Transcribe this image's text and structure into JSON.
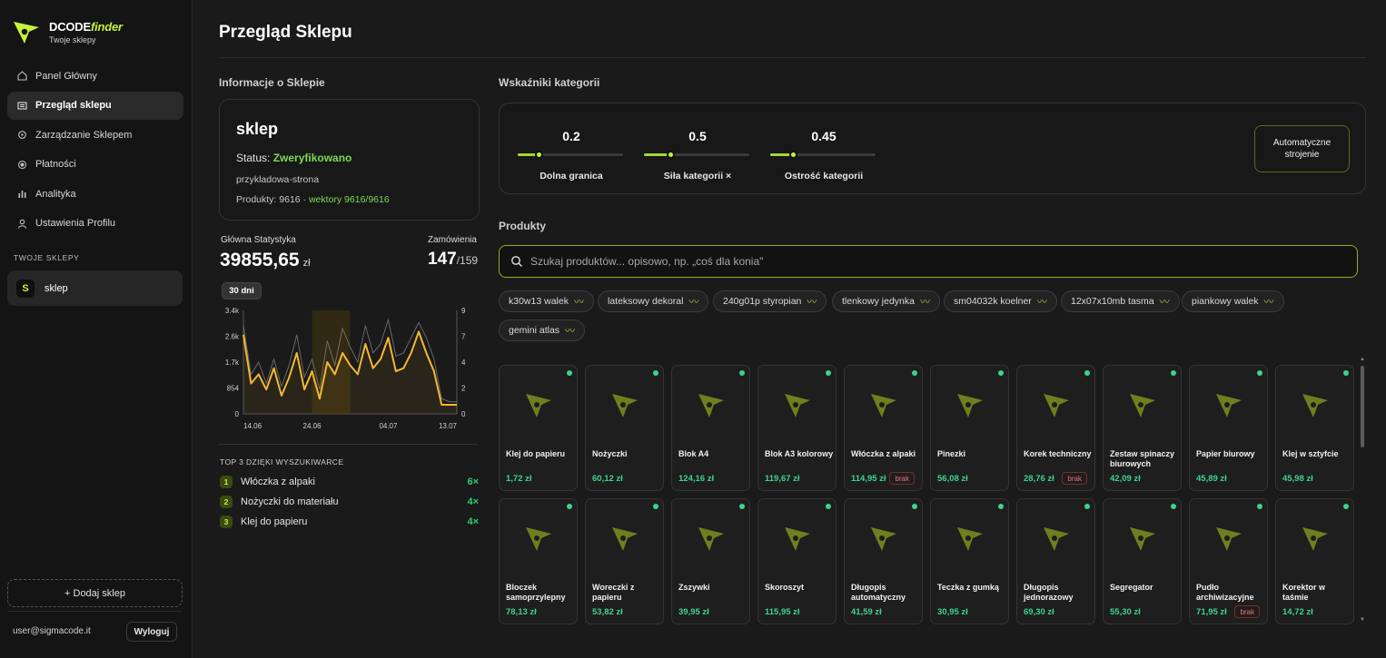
{
  "app": {
    "name_main": "DCODE",
    "name_accent": "finder",
    "subtitle": "Twoje sklepy",
    "accent": "#c4f23c"
  },
  "sidebar": {
    "items": [
      {
        "label": "Panel Główny",
        "icon": "home-icon"
      },
      {
        "label": "Przegląd sklepu",
        "icon": "store-icon",
        "active": true
      },
      {
        "label": "Zarządzanie Sklepem",
        "icon": "gear-icon"
      },
      {
        "label": "Płatności",
        "icon": "payment-icon"
      },
      {
        "label": "Analityka",
        "icon": "analytics-icon"
      },
      {
        "label": "Ustawienia Profilu",
        "icon": "user-icon"
      }
    ],
    "shops_label": "TWOJE SKLEPY",
    "shop": {
      "badge": "S",
      "name": "sklep"
    },
    "add_shop": "+ Dodaj sklep",
    "user_email": "user@sigmacode.it",
    "logout": "Wyloguj"
  },
  "page": {
    "title": "Przegląd Sklepu"
  },
  "shop_info": {
    "heading": "Informacje o Sklepie",
    "name": "sklep",
    "status_label": "Status:",
    "status_value": "Zweryfikowano",
    "site": "przykladowa-strona",
    "products_text": "Produkty: 9616 ·",
    "vectors_text": "wektory 9616/9616"
  },
  "stats": {
    "main_label": "Główna Statystyka",
    "main_value": "39855,65",
    "main_unit": "zł",
    "orders_label": "Zamówienia",
    "orders_value": "147",
    "orders_total": "/159",
    "period": "30 dni"
  },
  "chart_data": {
    "type": "line",
    "x_ticks": [
      "14.06",
      "24.06",
      "04.07",
      "13.07"
    ],
    "y_left_ticks": [
      "3.4k",
      "2.6k",
      "1.7k",
      "854",
      "0"
    ],
    "y_right_ticks": [
      "9",
      "7",
      "4",
      "2",
      "0"
    ],
    "ylim_left": [
      0,
      3400
    ],
    "ylim_right": [
      0,
      9
    ],
    "highlight_range": [
      9,
      14
    ],
    "series": [
      {
        "values": [
          2600,
          1000,
          1300,
          800,
          1500,
          600,
          1200,
          2000,
          800,
          1400,
          500,
          1700,
          1300,
          2000,
          1600,
          1300,
          2300,
          1500,
          1800,
          2500,
          1400,
          1500,
          2000,
          2700,
          2000,
          1400,
          300,
          300,
          300
        ]
      },
      {
        "values": [
          2900,
          1300,
          1700,
          1000,
          1800,
          900,
          1600,
          2600,
          1200,
          1800,
          800,
          2400,
          1600,
          2800,
          2200,
          1700,
          2900,
          2000,
          2300,
          3100,
          1900,
          2000,
          2500,
          3000,
          2500,
          1800,
          500,
          400,
          400
        ]
      }
    ]
  },
  "top_search": {
    "label": "TOP 3 DZIĘKI WYSZUKIWARCE",
    "items": [
      {
        "rank": "1",
        "name": "Włóczka z alpaki",
        "count": "6×"
      },
      {
        "rank": "2",
        "name": "Nożyczki do materiału",
        "count": "4×"
      },
      {
        "rank": "3",
        "name": "Klej do papieru",
        "count": "4×"
      }
    ]
  },
  "indicators": {
    "heading": "Wskaźniki kategorii",
    "sliders": [
      {
        "value": "0.2",
        "name": "Dolna granica",
        "level": 0.2
      },
      {
        "value": "0.5",
        "name": "Siła kategorii ×",
        "level": 0.25
      },
      {
        "value": "0.45",
        "name": "Ostrość kategorii",
        "level": 0.22
      }
    ],
    "auto_button": "Automatyczne strojenie"
  },
  "products": {
    "heading": "Produkty",
    "search_placeholder": "Szukaj produktów... opisowo, np. „coś dla konia\"",
    "chips": [
      "k30w13 walek",
      "lateksowy dekoral",
      "240g01p styropian",
      "tlenkowy jedynka",
      "sm04032k koelner",
      "12x07x10mb tasma",
      "piankowy walek",
      "gemini atlas"
    ],
    "out_of_stock_label": "brak",
    "items": [
      {
        "name": "Klej do papieru",
        "price": "1,72 zł"
      },
      {
        "name": "Nożyczki",
        "price": "60,12 zł"
      },
      {
        "name": "Blok A4",
        "price": "124,16 zł"
      },
      {
        "name": "Blok A3 kolorowy",
        "price": "119,67 zł"
      },
      {
        "name": "Włóczka z alpaki",
        "price": "114,95 zł",
        "brak": true
      },
      {
        "name": "Pinezki",
        "price": "56,08 zł"
      },
      {
        "name": "Korek techniczny",
        "price": "28,76 zł",
        "brak": true
      },
      {
        "name": "Zestaw spinaczy biurowych",
        "price": "42,09 zł"
      },
      {
        "name": "Papier biurowy",
        "price": "45,89 zł"
      },
      {
        "name": "Klej w sztyfcie",
        "price": "45,98 zł"
      },
      {
        "name": "Bloczek samoprzylepny",
        "price": "78,13 zł"
      },
      {
        "name": "Woreczki z papieru",
        "price": "53,82 zł"
      },
      {
        "name": "Zszywki",
        "price": "39,95 zł"
      },
      {
        "name": "Skoroszyt",
        "price": "115,95 zł"
      },
      {
        "name": "Długopis automatyczny",
        "price": "41,59 zł"
      },
      {
        "name": "Teczka z gumką",
        "price": "30,95 zł"
      },
      {
        "name": "Długopis jednorazowy",
        "price": "69,30 zł"
      },
      {
        "name": "Segregator",
        "price": "55,30 zł"
      },
      {
        "name": "Pudło archiwizacyjne",
        "price": "71,95 zł",
        "brak": true
      },
      {
        "name": "Korektor w taśmie",
        "price": "14,72 zł"
      }
    ]
  }
}
